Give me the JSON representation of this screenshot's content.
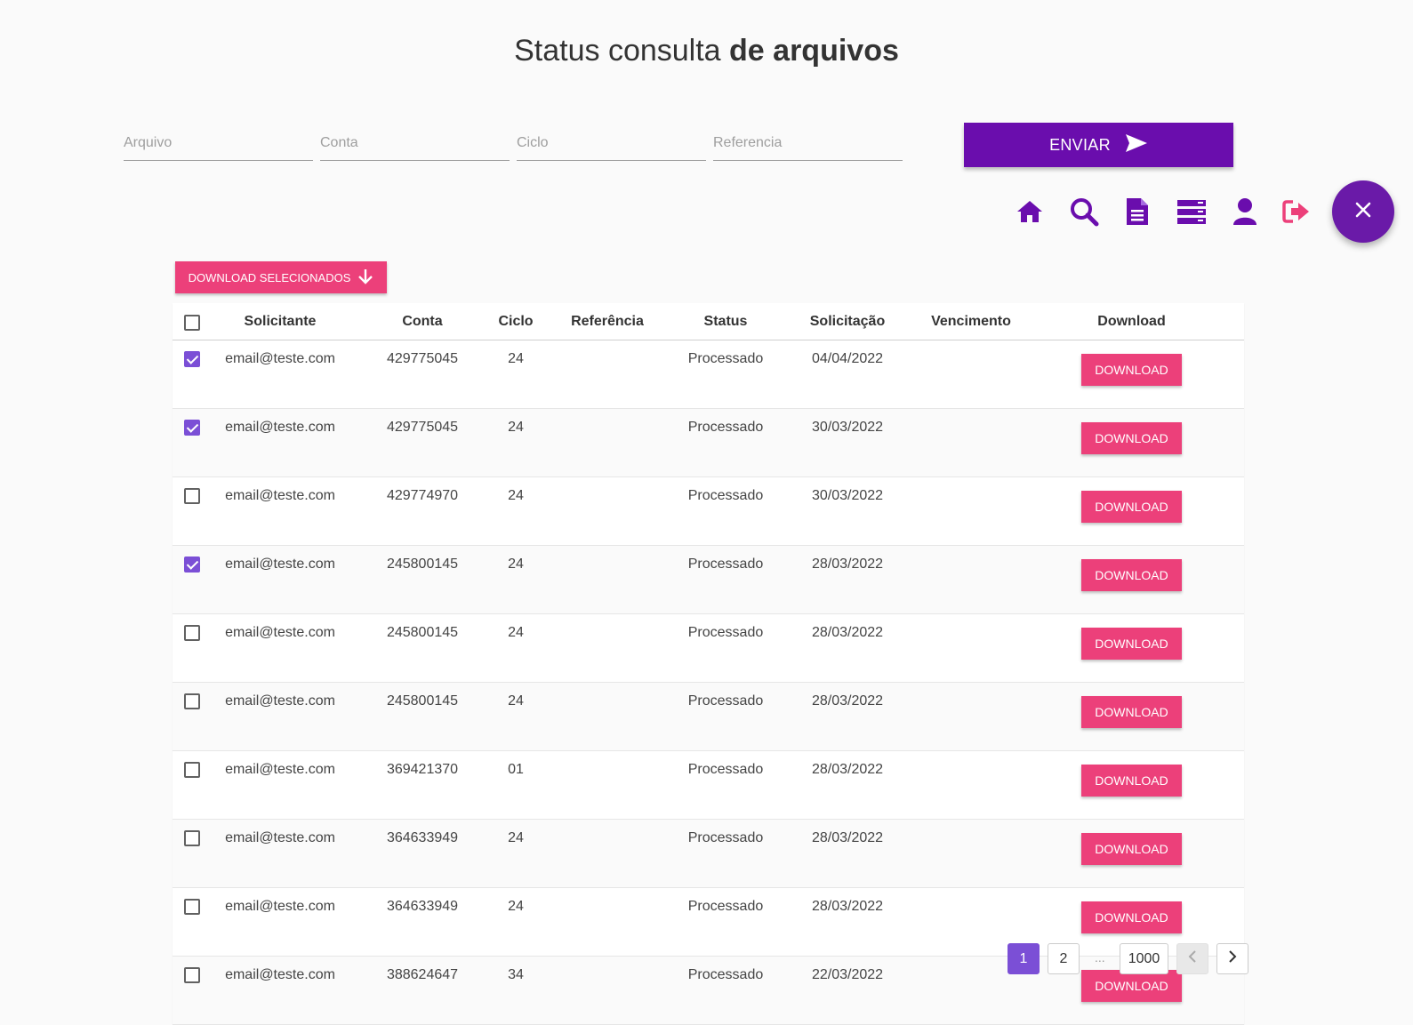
{
  "title": {
    "light": "Status consulta ",
    "bold": "de arquivos"
  },
  "filters": {
    "arquivo_placeholder": "Arquivo",
    "conta_placeholder": "Conta",
    "ciclo_placeholder": "Ciclo",
    "referencia_placeholder": "Referencia",
    "send_label": "ENVIAR"
  },
  "toolbar": [
    "home-icon",
    "search-icon",
    "document-icon",
    "list-icon",
    "user-icon",
    "logout-icon"
  ],
  "colors": {
    "primary": "#6a0dad",
    "accent": "#ec407a",
    "checkbox": "#7b4fd6"
  },
  "download_selected_label": "DOWNLOAD SELECIONADOS",
  "table": {
    "headers": [
      "Solicitante",
      "Conta",
      "Ciclo",
      "Referência",
      "Status",
      "Solicitação",
      "Vencimento",
      "Download"
    ],
    "download_label": "DOWNLOAD",
    "rows": [
      {
        "checked": true,
        "solicitante": "email@teste.com",
        "conta": "429775045",
        "ciclo": "24",
        "referencia": "",
        "status": "Processado",
        "solicitacao": "04/04/2022",
        "vencimento": ""
      },
      {
        "checked": true,
        "solicitante": "email@teste.com",
        "conta": "429775045",
        "ciclo": "24",
        "referencia": "",
        "status": "Processado",
        "solicitacao": "30/03/2022",
        "vencimento": ""
      },
      {
        "checked": false,
        "solicitante": "email@teste.com",
        "conta": "429774970",
        "ciclo": "24",
        "referencia": "",
        "status": "Processado",
        "solicitacao": "30/03/2022",
        "vencimento": ""
      },
      {
        "checked": true,
        "solicitante": "email@teste.com",
        "conta": "245800145",
        "ciclo": "24",
        "referencia": "",
        "status": "Processado",
        "solicitacao": "28/03/2022",
        "vencimento": ""
      },
      {
        "checked": false,
        "solicitante": "email@teste.com",
        "conta": "245800145",
        "ciclo": "24",
        "referencia": "",
        "status": "Processado",
        "solicitacao": "28/03/2022",
        "vencimento": ""
      },
      {
        "checked": false,
        "solicitante": "email@teste.com",
        "conta": "245800145",
        "ciclo": "24",
        "referencia": "",
        "status": "Processado",
        "solicitacao": "28/03/2022",
        "vencimento": ""
      },
      {
        "checked": false,
        "solicitante": "email@teste.com",
        "conta": "369421370",
        "ciclo": "01",
        "referencia": "",
        "status": "Processado",
        "solicitacao": "28/03/2022",
        "vencimento": ""
      },
      {
        "checked": false,
        "solicitante": "email@teste.com",
        "conta": "364633949",
        "ciclo": "24",
        "referencia": "",
        "status": "Processado",
        "solicitacao": "28/03/2022",
        "vencimento": ""
      },
      {
        "checked": false,
        "solicitante": "email@teste.com",
        "conta": "364633949",
        "ciclo": "24",
        "referencia": "",
        "status": "Processado",
        "solicitacao": "28/03/2022",
        "vencimento": ""
      },
      {
        "checked": false,
        "solicitante": "email@teste.com",
        "conta": "388624647",
        "ciclo": "34",
        "referencia": "",
        "status": "Processado",
        "solicitacao": "22/03/2022",
        "vencimento": ""
      }
    ]
  },
  "pagination": {
    "pages": [
      "1",
      "2"
    ],
    "ellipsis": "...",
    "last": "1000",
    "current": "1"
  }
}
